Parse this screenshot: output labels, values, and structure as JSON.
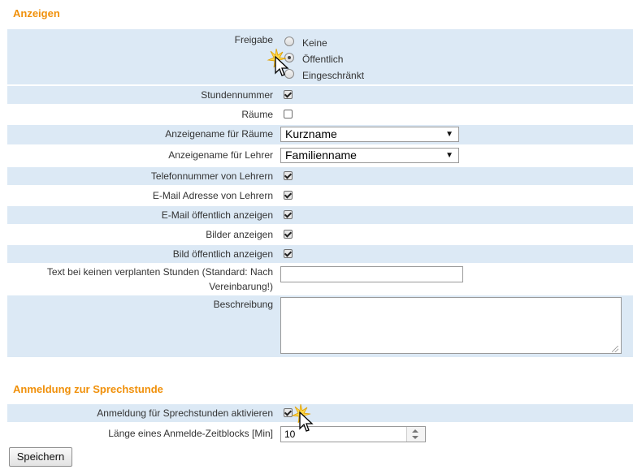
{
  "section_display": {
    "title": "Anzeigen"
  },
  "freigabe": {
    "label": "Freigabe",
    "options": [
      {
        "label": "Keine",
        "checked": false
      },
      {
        "label": "Öffentlich",
        "checked": true
      },
      {
        "label": "Eingeschränkt",
        "checked": false
      }
    ]
  },
  "fields": {
    "stundennummer": {
      "label": "Stundennummer",
      "checked": true
    },
    "raeume": {
      "label": "Räume",
      "checked": false
    },
    "anzeigename_raeume": {
      "label": "Anzeigename für Räume",
      "value": "Kurzname"
    },
    "anzeigename_lehrer": {
      "label": "Anzeigename für Lehrer",
      "value": "Familienname"
    },
    "telefon": {
      "label": "Telefonnummer von Lehrern",
      "checked": true
    },
    "email": {
      "label": "E-Mail Adresse von Lehrern",
      "checked": true
    },
    "email_public": {
      "label": "E-Mail öffentlich anzeigen",
      "checked": true
    },
    "bilder": {
      "label": "Bilder anzeigen",
      "checked": true
    },
    "bild_public": {
      "label": "Bild öffentlich anzeigen",
      "checked": true
    },
    "text_keine_stunden": {
      "label_line1": "Text bei keinen verplanten Stunden (Standard: Nach",
      "label_line2": "Vereinbarung!)",
      "value": ""
    },
    "beschreibung": {
      "label": "Beschreibung",
      "value": ""
    }
  },
  "section_booking": {
    "title": "Anmeldung zur Sprechstunde"
  },
  "booking": {
    "aktivieren": {
      "label": "Anmeldung für Sprechstunden aktivieren",
      "checked": true
    },
    "laenge": {
      "label": "Länge eines Anmelde-Zeitblocks [Min]",
      "value": "10"
    }
  },
  "save_button": {
    "label": "Speichern"
  },
  "colors": {
    "accent": "#f0900a",
    "row_alt": "#dce9f5"
  }
}
